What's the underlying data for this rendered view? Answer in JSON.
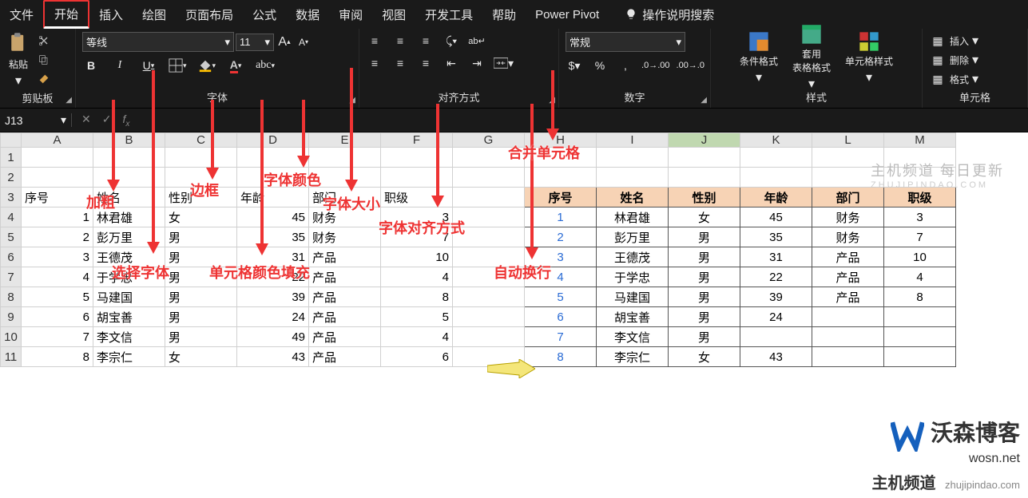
{
  "tabs": {
    "file": "文件",
    "home": "开始",
    "insert": "插入",
    "draw": "绘图",
    "layout": "页面布局",
    "formulas": "公式",
    "data": "数据",
    "review": "审阅",
    "view": "视图",
    "dev": "开发工具",
    "help": "帮助",
    "pivot": "Power Pivot",
    "search": "操作说明搜索"
  },
  "ribbon": {
    "clipboard": {
      "paste": "粘贴",
      "label": "剪贴板"
    },
    "font": {
      "name": "等线",
      "size": "11",
      "label": "字体"
    },
    "align": {
      "label": "对齐方式"
    },
    "number": {
      "format": "常规",
      "label": "数字"
    },
    "styles": {
      "cond": "条件格式",
      "tbl": "套用\n表格格式",
      "cell": "单元格样式",
      "label": "样式"
    },
    "cells": {
      "insert": "插入",
      "delete": "删除",
      "format": "格式",
      "label": "单元格"
    }
  },
  "formula_bar": {
    "name": "J13"
  },
  "annotations": {
    "bold": "加粗",
    "select_font": "选择字体",
    "border": "边框",
    "fill": "单元格颜色填充",
    "font_color": "字体颜色",
    "font_size": "字体大小",
    "align": "字体对齐方式",
    "merge": "合并单元格",
    "wrap": "自动换行"
  },
  "columns": [
    "A",
    "B",
    "C",
    "D",
    "E",
    "F",
    "G",
    "H",
    "I",
    "J",
    "K",
    "L",
    "M"
  ],
  "selected_column_index": 9,
  "row_header": [
    1,
    2,
    3,
    4,
    5,
    6,
    7,
    8,
    9,
    10,
    11
  ],
  "plain_table": {
    "headers": {
      "idx": "序号",
      "name": "姓名",
      "gender": "性别",
      "age": "年龄",
      "dept": "部门",
      "level": "职级"
    },
    "rows": [
      {
        "idx": 1,
        "name": "林君雄",
        "gender": "女",
        "age": 45,
        "dept": "财务",
        "level": 3
      },
      {
        "idx": 2,
        "name": "彭万里",
        "gender": "男",
        "age": 35,
        "dept": "财务",
        "level": 7
      },
      {
        "idx": 3,
        "name": "王德茂",
        "gender": "男",
        "age": 31,
        "dept": "产品",
        "level": 10
      },
      {
        "idx": 4,
        "name": "于学忠",
        "gender": "男",
        "age": 22,
        "dept": "产品",
        "level": 4
      },
      {
        "idx": 5,
        "name": "马建国",
        "gender": "男",
        "age": 39,
        "dept": "产品",
        "level": 8
      },
      {
        "idx": 6,
        "name": "胡宝善",
        "gender": "男",
        "age": 24,
        "dept": "产品",
        "level": 5
      },
      {
        "idx": 7,
        "name": "李文信",
        "gender": "男",
        "age": 49,
        "dept": "产品",
        "level": 4
      },
      {
        "idx": 8,
        "name": "李宗仁",
        "gender": "女",
        "age": 43,
        "dept": "产品",
        "level": 6
      }
    ]
  },
  "formatted_table": {
    "headers": [
      "序号",
      "姓名",
      "性别",
      "年龄",
      "部门",
      "职级"
    ],
    "rows": [
      [
        "1",
        "林君雄",
        "女",
        "45",
        "财务",
        "3"
      ],
      [
        "2",
        "彭万里",
        "男",
        "35",
        "财务",
        "7"
      ],
      [
        "3",
        "王德茂",
        "男",
        "31",
        "产品",
        "10"
      ],
      [
        "4",
        "于学忠",
        "男",
        "22",
        "产品",
        "4"
      ],
      [
        "5",
        "马建国",
        "男",
        "39",
        "产品",
        "8"
      ],
      [
        "6",
        "胡宝善",
        "男",
        "24",
        "",
        ""
      ],
      [
        "7",
        "李文信",
        "男",
        "",
        "",
        ""
      ],
      [
        "8",
        "李宗仁",
        "女",
        "43",
        "",
        ""
      ]
    ]
  },
  "watermark": {
    "cn": "主机频道 每日更新",
    "en": "ZHUJIPINDAO.COM"
  },
  "brand1": {
    "name": "沃森博客",
    "url": "wosn.net"
  },
  "brand2": {
    "name": "主机频道",
    "url": "zhujipindao.com"
  }
}
